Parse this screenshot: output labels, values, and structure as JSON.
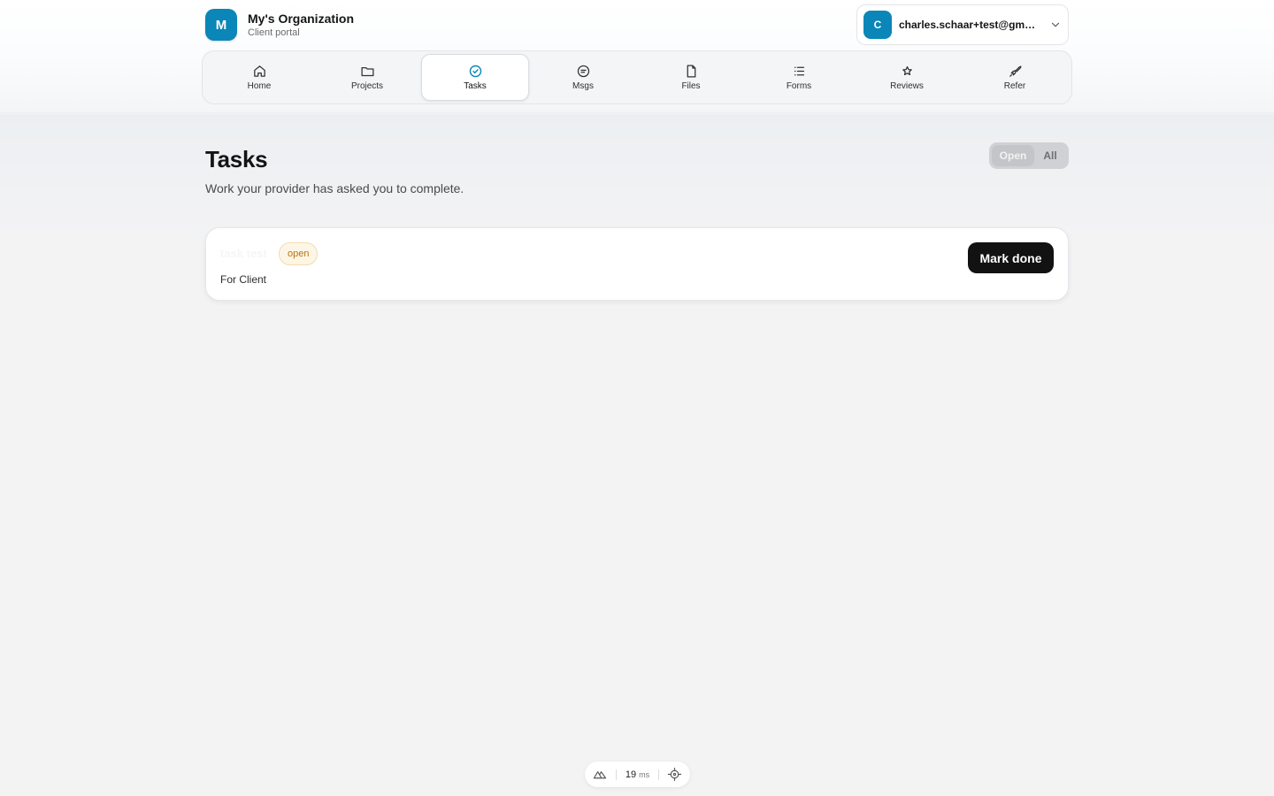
{
  "org": {
    "logo_letter": "M",
    "name": "My's Organization",
    "subtitle": "Client portal"
  },
  "account": {
    "avatar_letter": "C",
    "email": "charles.schaar+test@gmail...."
  },
  "nav": {
    "items": [
      {
        "label": "Home",
        "icon": "home-icon"
      },
      {
        "label": "Projects",
        "icon": "folder-icon"
      },
      {
        "label": "Tasks",
        "icon": "check-circle-icon",
        "active": true
      },
      {
        "label": "Msgs",
        "icon": "message-icon"
      },
      {
        "label": "Files",
        "icon": "file-icon"
      },
      {
        "label": "Forms",
        "icon": "list-icon"
      },
      {
        "label": "Reviews",
        "icon": "star-icon"
      },
      {
        "label": "Refer",
        "icon": "rocket-icon"
      }
    ]
  },
  "page": {
    "title": "Tasks",
    "subtitle": "Work your provider has asked you to complete."
  },
  "filter": {
    "open_label": "Open",
    "all_label": "All",
    "selected": "Open"
  },
  "tasks": [
    {
      "name": "task test",
      "status": "open",
      "assignee": "For Client",
      "action_label": "Mark done"
    }
  ],
  "devbar": {
    "time_value": "19",
    "time_unit": "ms",
    "left_icon": "nuxt-icon",
    "right_icon": "target-icon"
  },
  "colors": {
    "brand": "#0a86b8",
    "badge_text": "#b9730d",
    "badge_bg": "#fdf6e6",
    "button_bg": "#121212"
  }
}
